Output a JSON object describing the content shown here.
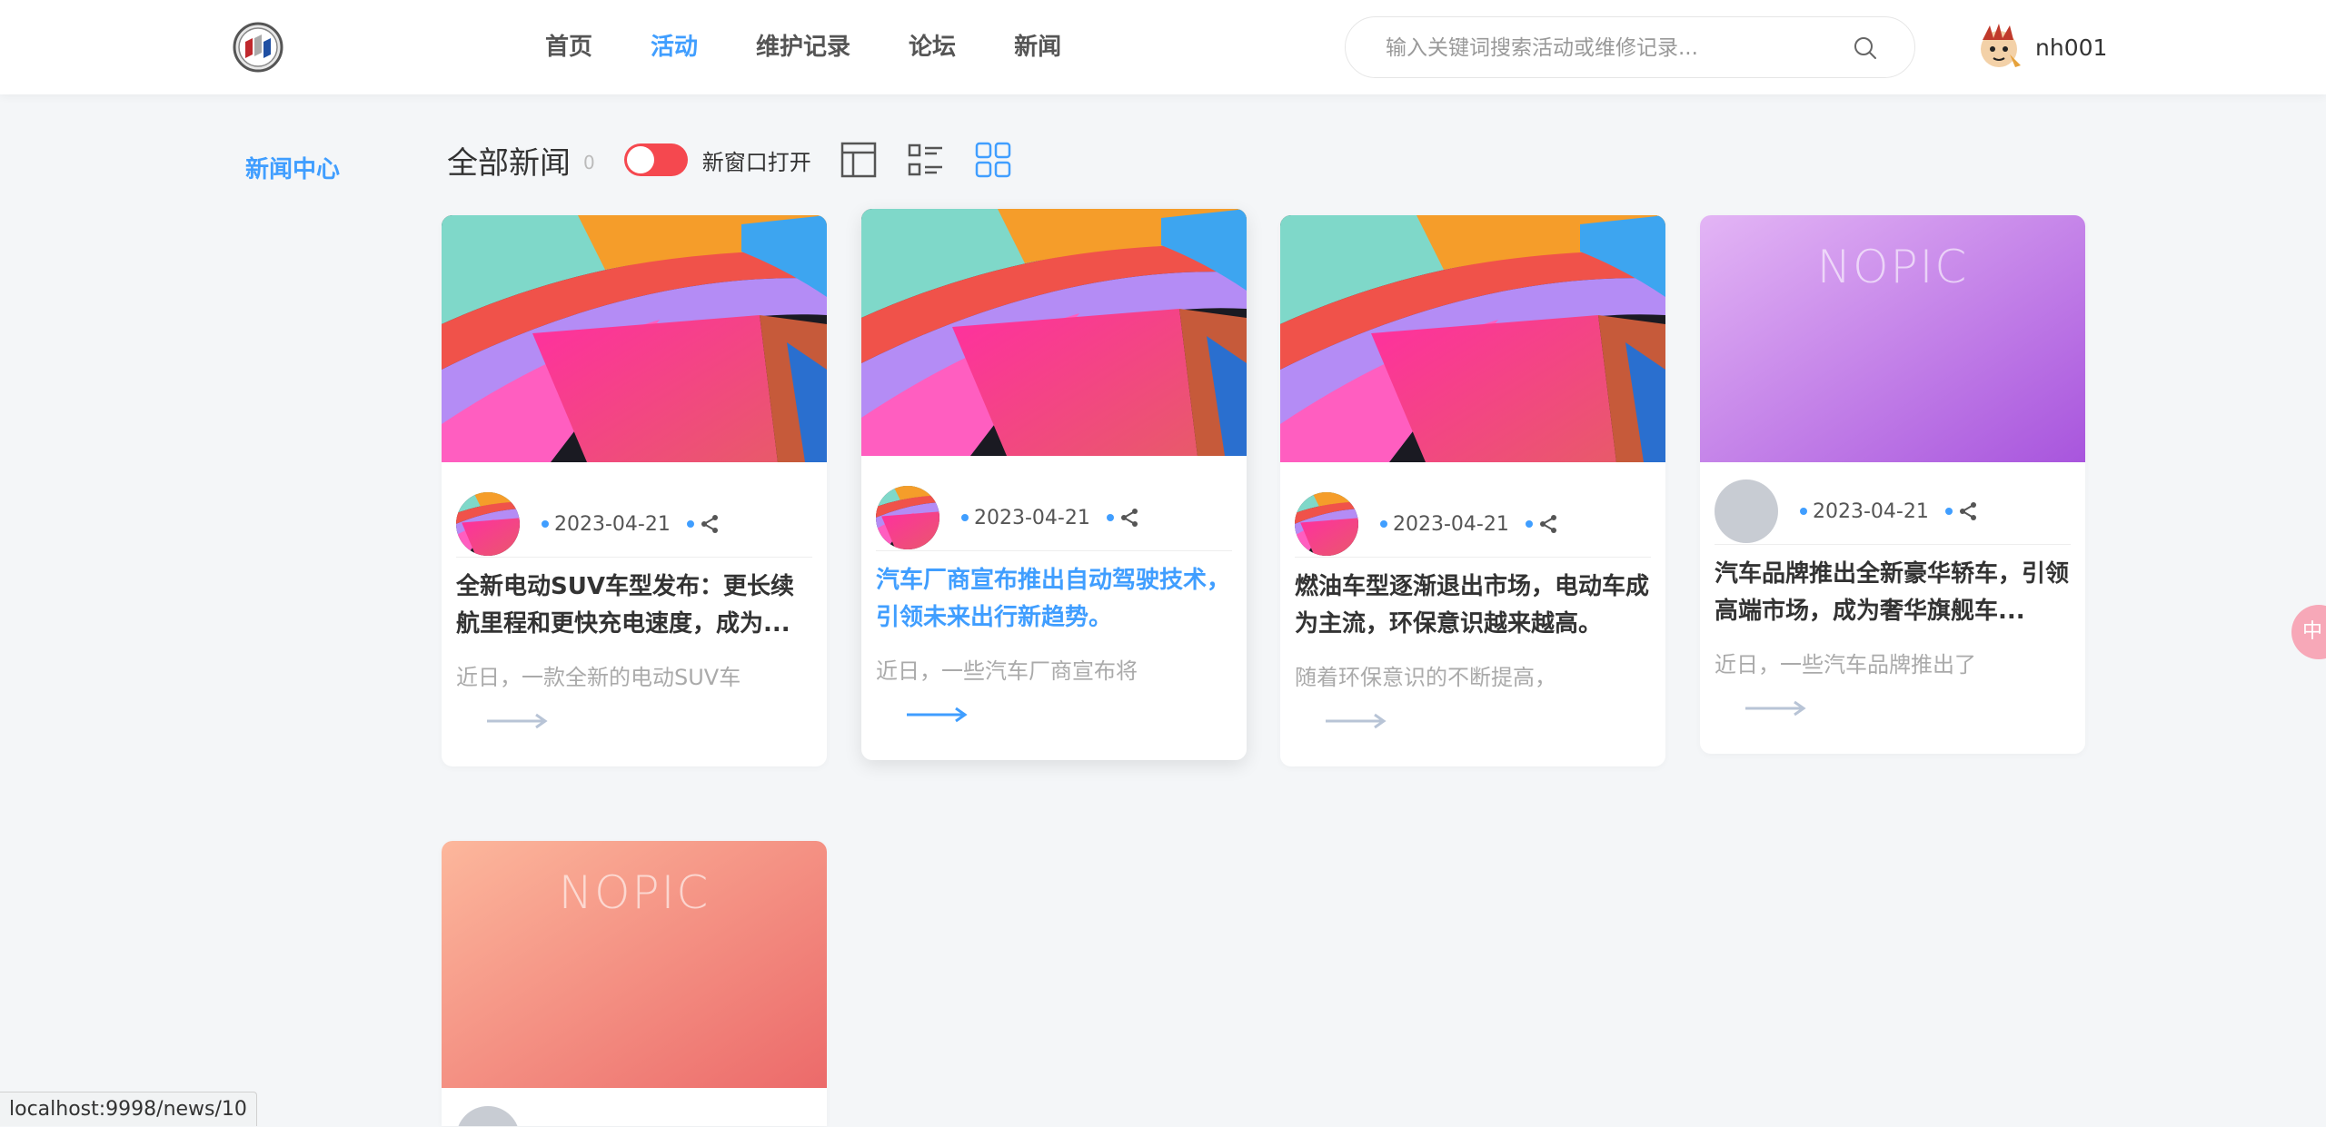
{
  "header": {
    "nav": [
      "首页",
      "活动",
      "维护记录",
      "论坛",
      "新闻"
    ],
    "active_nav": "活动",
    "search_placeholder": "输入关键词搜索活动或维修记录...",
    "username": "nh001"
  },
  "sidebar": {
    "link": "新闻中心"
  },
  "toolbar": {
    "title": "全部新闻",
    "count": "0",
    "toggle_label": "新窗口打开",
    "toggle_on": true
  },
  "cards": [
    {
      "date": "2023-04-21",
      "title": "全新电动SUV车型发布：更长续航里程和更快充电速度，成为...",
      "excerpt": "近日，一款全新的电动SUV车",
      "image": "abstract"
    },
    {
      "date": "2023-04-21",
      "title": "汽车厂商宣布推出自动驾驶技术，引领未来出行新趋势。",
      "excerpt": "近日，一些汽车厂商宣布将",
      "image": "abstract",
      "hovered": true
    },
    {
      "date": "2023-04-21",
      "title": "燃油车型逐渐退出市场，电动车成为主流，环保意识越来越高。",
      "excerpt": "随着环保意识的不断提高，",
      "image": "abstract"
    },
    {
      "date": "2023-04-21",
      "title": "汽车品牌推出全新豪华轿车，引领高端市场，成为奢华旗舰车...",
      "excerpt": "近日，一些汽车品牌推出了",
      "image": "nopic-purple",
      "placeholder_text": "NOPIC"
    },
    {
      "image": "nopic-orange",
      "placeholder_text": "NOPIC"
    }
  ],
  "statusbar": {
    "url": "localhost:9998/news/10"
  },
  "float_widget": {
    "text": "中"
  },
  "colors": {
    "accent": "#409eff",
    "toggle": "#f5484f",
    "background": "#f4f6f8"
  },
  "icons": [
    "buick-logo-icon",
    "search-icon",
    "user-avatar",
    "layout-icon",
    "list-icon",
    "grid-icon",
    "share-icon",
    "arrow-right-icon"
  ]
}
